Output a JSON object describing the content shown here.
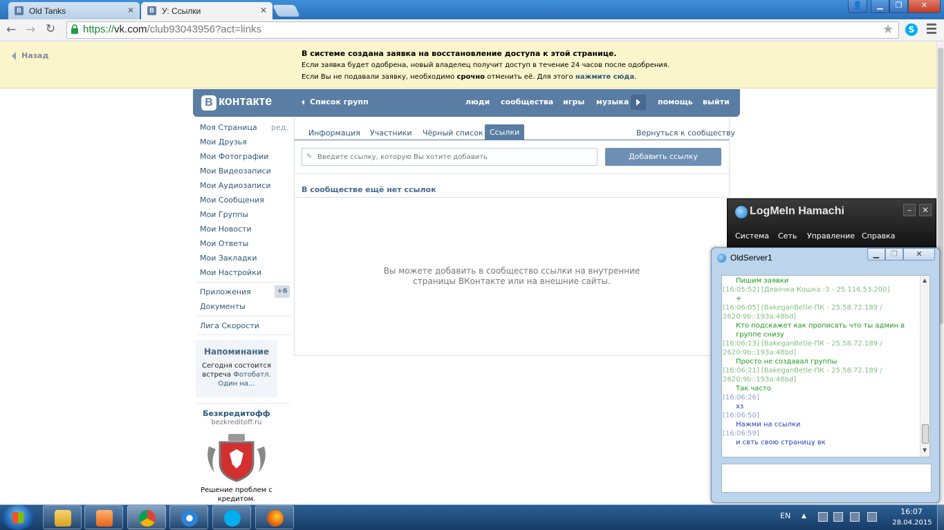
{
  "browser": {
    "tabs": [
      {
        "label": "Old Tanks",
        "favicon": "В"
      },
      {
        "label": "У: Ссылки",
        "favicon": "В"
      }
    ],
    "url_scheme": "https://",
    "url_host": "vk.com",
    "url_rest": "/club93043956?act=links"
  },
  "banner": {
    "back_label": "Назад",
    "line1": "В системе создана заявка на восстановление доступа к этой странице.",
    "line2": "Если заявка будет одобрена, новый владелец получит доступ в течение 24 часов после одобрения.",
    "line3_a": "Если Вы не подавали заявку, необходимо",
    "line3_b": "срочно",
    "line3_c": "отменить её. Для этого",
    "line3_link": "нажмите сюда",
    "line3_end": "."
  },
  "vk_header": {
    "logo_letter": "В",
    "logo_text": "контакте",
    "group_list": "Список групп",
    "nav": [
      "люди",
      "сообщества",
      "игры",
      "музыка",
      "помощь",
      "выйти"
    ]
  },
  "left_menu": {
    "items": [
      "Моя Страница",
      "Мои Друзья",
      "Мои Фотографии",
      "Мои Видеозаписи",
      "Мои Аудиозаписи",
      "Мои Сообщения",
      "Мои Группы",
      "Мои Новости",
      "Мои Ответы",
      "Мои Закладки",
      "Мои Настройки"
    ],
    "edit": "ред.",
    "apps": "Приложения",
    "apps_badge": "+6",
    "docs": "Документы",
    "league": "Лига Скорости",
    "reminder_title": "Напоминание",
    "reminder_a": "Сегодня состоится встреча",
    "reminder_link": "Фотобатл. Один на...",
    "ad_title": "Безкредитофф",
    "ad_url": "bezkreditoff.ru",
    "ad_text": "Решение проблем с кредитом."
  },
  "main": {
    "tabs": [
      "Информация",
      "Участники",
      "Чёрный список",
      "Ссылки"
    ],
    "return_link": "Вернуться к сообществу",
    "input_placeholder": "Введите ссылку, которую Вы хотите добавить",
    "add_button": "Добавить ссылку",
    "no_links": "В сообществе ещё нет ссылок",
    "empty_msg": "Вы можете добавить в сообщество ссылки на внутренние страницы ВКонтакте или на внешние сайты."
  },
  "hamachi": {
    "title": "LogMeIn Hamachi",
    "menu": [
      "Система",
      "Сеть",
      "Управление",
      "Справка"
    ]
  },
  "chat": {
    "title": "OldServer1",
    "lines": [
      {
        "text": "Пишим заявки",
        "kind": "msg"
      },
      {
        "text": "[16:05:52]      [Девочка Кошка :3 - 25.116.53.200]",
        "kind": "ts"
      },
      {
        "text": "+",
        "kind": "msg"
      },
      {
        "text": "[16:06:05]      [BakeganBetle-ПК - 25.58.72.189 /",
        "kind": "ts"
      },
      {
        "text": "2620:9b::193a:48bd]",
        "kind": "ts"
      },
      {
        "text": "Кто подскажет как прописать что ты админ в",
        "kind": "msg"
      },
      {
        "text": "группе снизу",
        "kind": "msg"
      },
      {
        "text": "[16:06:13]      [BakeganBetle-ПК - 25.58.72.189 /",
        "kind": "ts"
      },
      {
        "text": "2620:9b::193a:48bd]",
        "kind": "ts"
      },
      {
        "text": "Просто не создавал группы",
        "kind": "msg"
      },
      {
        "text": "[16:06:21]      [BakeganBetle-ПК - 25.58.72.189 /",
        "kind": "ts"
      },
      {
        "text": "2620:9b::193a:48bd]",
        "kind": "ts"
      },
      {
        "text": "Так часто",
        "kind": "msg"
      },
      {
        "text": "[16:06:26]",
        "kind": "tsb"
      },
      {
        "text": "хз",
        "kind": "msgb"
      },
      {
        "text": "[16:06:50]",
        "kind": "tsb"
      },
      {
        "text": "Нажми на ссылки",
        "kind": "msgb"
      },
      {
        "text": "[16:06:59]",
        "kind": "tsb"
      },
      {
        "text": "и свть свою страницу вк",
        "kind": "msgb"
      }
    ]
  },
  "taskbar": {
    "lang": "EN",
    "time": "16:07",
    "date": "28.04.2015"
  },
  "colors": {
    "vk_blue": "#597da3",
    "banner_bg": "#fbf5cc",
    "link": "#2b587a",
    "chat_green": "#1a9a1a",
    "chat_blue": "#1f3fbf"
  },
  "icons": [
    "back-arrow-icon",
    "forward-arrow-icon",
    "reload-icon",
    "lock-icon",
    "star-icon",
    "skype-icon",
    "menu-icon",
    "start-icon",
    "explorer-icon",
    "media-player-icon",
    "chrome-icon",
    "hamachi-icon",
    "firefox-icon"
  ]
}
